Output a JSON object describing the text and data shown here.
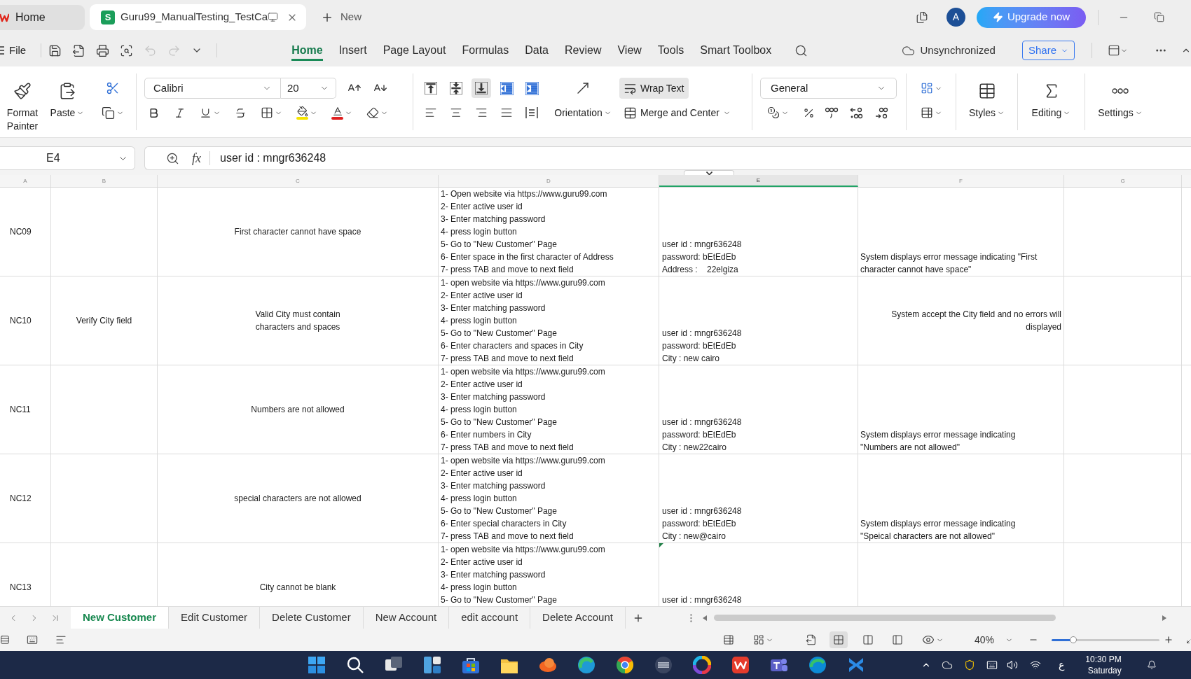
{
  "title_bar": {
    "tabs": [
      {
        "kind": "home",
        "label": "Home",
        "selected": false
      },
      {
        "kind": "document",
        "badge": "S",
        "label": "Guru99_ManualTesting_TestCa",
        "selected": true
      }
    ],
    "new_tab": "New",
    "avatar": "A",
    "upgrade": "Upgrade now"
  },
  "menu_bar": {
    "file": "File",
    "quick_access": [
      {
        "kind": "save",
        "disabled": false
      },
      {
        "kind": "export",
        "disabled": false
      },
      {
        "kind": "print",
        "disabled": false
      },
      {
        "kind": "preview",
        "disabled": false
      },
      {
        "kind": "undo",
        "disabled": true
      },
      {
        "kind": "redo",
        "disabled": true
      }
    ],
    "tabs": [
      {
        "label": "Home",
        "selected": true
      },
      {
        "label": "Insert",
        "selected": false
      },
      {
        "label": "Page Layout",
        "selected": false
      },
      {
        "label": "Formulas",
        "selected": false
      },
      {
        "label": "Data",
        "selected": false
      },
      {
        "label": "Review",
        "selected": false
      },
      {
        "label": "View",
        "selected": false
      },
      {
        "label": "Tools",
        "selected": false
      },
      {
        "label": "Smart Toolbox",
        "selected": false
      }
    ],
    "sync_status": "Unsynchronized",
    "share": "Share"
  },
  "ribbon": {
    "format_painter": "Format Painter",
    "paste": "Paste",
    "font": "Calibri",
    "font_size": "20",
    "vertical_align": [
      {
        "kind": "top",
        "selected": false
      },
      {
        "kind": "middle",
        "selected": false
      },
      {
        "kind": "bottom",
        "selected": true
      }
    ],
    "orientation": "Orientation",
    "wrap_text": {
      "label": "Wrap Text",
      "selected": true
    },
    "merge": "Merge and Center",
    "number_format": "General",
    "styles": "Styles",
    "editing": "Editing",
    "settings": "Settings"
  },
  "formula_bar": {
    "cell": "E4",
    "function_label": "fx",
    "formula": "user id : mngr636248"
  },
  "sheet": {
    "columns": [
      {
        "label": "A",
        "selected": false
      },
      {
        "label": "B",
        "selected": false
      },
      {
        "label": "C",
        "selected": false
      },
      {
        "label": "D",
        "selected": false
      },
      {
        "label": "E",
        "selected": true
      },
      {
        "label": "F",
        "selected": false
      },
      {
        "label": "G",
        "selected": false
      }
    ],
    "rows": [
      {
        "a": "NC09",
        "c": "First character cannot have space",
        "d": [
          "1- Open website via https://www.guru99.com",
          "2- Enter active user id",
          "3- Enter matching password",
          "4- press login button",
          "5- Go to \"New Customer\" Page",
          "6- Enter space in the first character of Address",
          "7- press TAB and move to next field"
        ],
        "e": [
          "user id : mngr636248",
          "password: bEtEdEb",
          "Address :    22elgiza"
        ],
        "e_indicator": false,
        "f": {
          "kind": "left",
          "text": "System displays error message indicating \"First\ncharacter cannot have space\""
        }
      },
      {
        "a": "NC10",
        "b": "Verify City field",
        "c": "Valid City must contain\ncharacters and spaces",
        "d": [
          "1- open website via https://www.guru99.com",
          "2- Enter active user id",
          "3- Enter matching password",
          "4- press login button",
          "5- Go to \"New Customer\" Page",
          "6- Enter characters and spaces in City",
          "7- press TAB and move to next field"
        ],
        "e": [
          "user id : mngr636248",
          "password: bEtEdEb",
          "City : new cairo"
        ],
        "e_indicator": false,
        "f": {
          "kind": "right",
          "text": "System accept the City field and no errors will\ndisplayed"
        }
      },
      {
        "a": "NC11",
        "c": "Numbers are not allowed",
        "d": [
          "1- open website via https://www.guru99.com",
          "2- Enter active user id",
          "3- Enter matching password",
          "4- press login button",
          "5- Go to \"New Customer\" Page",
          "6- Enter numbers in City",
          "7- press TAB and move to next field"
        ],
        "e": [
          "user id : mngr636248",
          "password: bEtEdEb",
          "City : new22cairo"
        ],
        "e_indicator": false,
        "f": {
          "kind": "left",
          "text": "System displays error message indicating\n\"Numbers are not allowed\""
        }
      },
      {
        "a": "NC12",
        "c": "special characters are not allowed",
        "d": [
          "1- open website via https://www.guru99.com",
          "2- Enter active user id",
          "3- Enter matching password",
          "4- press login button",
          "5- Go to \"New Customer\" Page",
          "6- Enter special characters in City",
          "7- press TAB and move to next field"
        ],
        "e": [
          "user id : mngr636248",
          "password: bEtEdEb",
          "City : new@cairo"
        ],
        "e_indicator": false,
        "f": {
          "kind": "left",
          "text": "System displays error message indicating\n\"Speical characters are not allowed\""
        }
      },
      {
        "a": "NC13",
        "c": "City cannot be blank",
        "d": [
          "1- open website via https://www.guru99.com",
          "2- Enter active user id",
          "3- Enter matching password",
          "4- press login button",
          "5- Go to \"New Customer\" Page"
        ],
        "e": [
          "user id : mngr636248"
        ],
        "e_indicator": true
      }
    ]
  },
  "sheet_tabs": [
    {
      "label": "New Customer",
      "selected": true
    },
    {
      "label": "Edit Customer",
      "selected": false
    },
    {
      "label": "Delete Customer",
      "selected": false
    },
    {
      "label": "New Account",
      "selected": false
    },
    {
      "label": "edit account",
      "selected": false
    },
    {
      "label": "Delete Account",
      "selected": false
    }
  ],
  "status_bar": {
    "views": [
      {
        "kind": "normal",
        "selected": true
      },
      {
        "kind": "page_layout",
        "selected": false
      },
      {
        "kind": "page_break",
        "selected": false
      }
    ],
    "zoom": "40%",
    "zoom_slider": {
      "level": 0.2
    }
  },
  "taskbar": {
    "input_language": "ع",
    "time": "10:30 PM",
    "day": "Saturday"
  }
}
